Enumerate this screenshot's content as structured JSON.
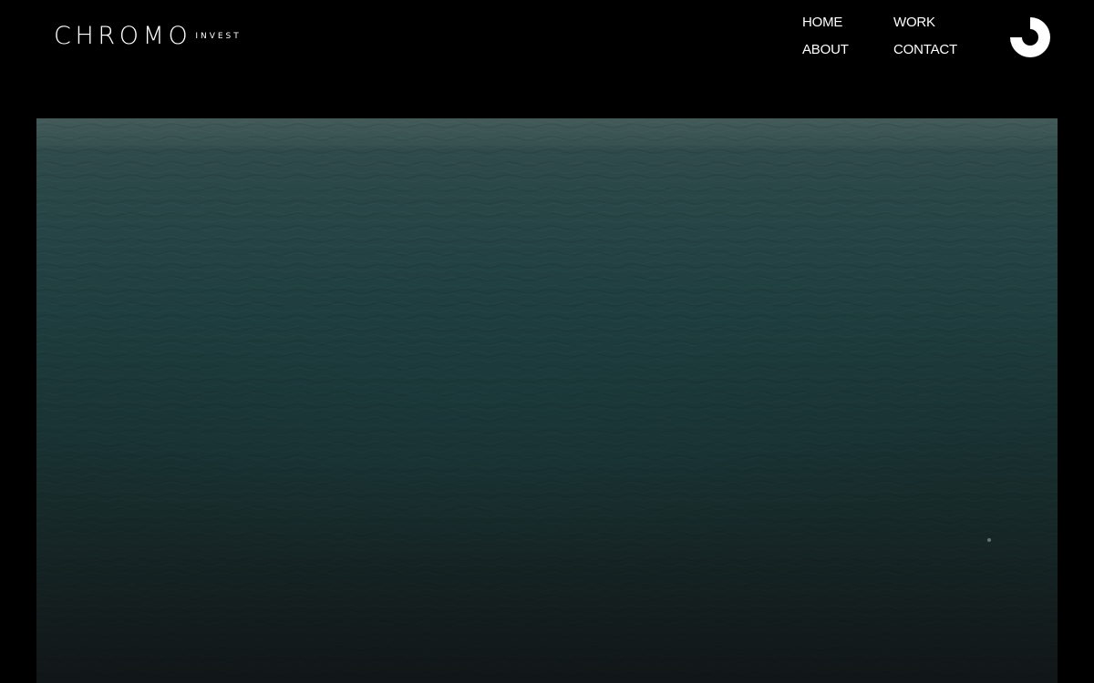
{
  "brand": {
    "name": "CHROMO",
    "suffix": "INVEST"
  },
  "nav": {
    "items": [
      {
        "label": "HOME"
      },
      {
        "label": "WORK"
      },
      {
        "label": "ABOUT"
      },
      {
        "label": "CONTACT"
      }
    ]
  },
  "brand_mark": {
    "icon": "chromo-c-logo-icon",
    "color": "#ffffff"
  },
  "hero": {
    "media": "aerial ocean video",
    "palette": {
      "top": "#3f5655",
      "middle": "#1f3d3e",
      "bottom": "#111617"
    }
  },
  "colors": {
    "background": "#000000",
    "text": "#ffffff"
  }
}
